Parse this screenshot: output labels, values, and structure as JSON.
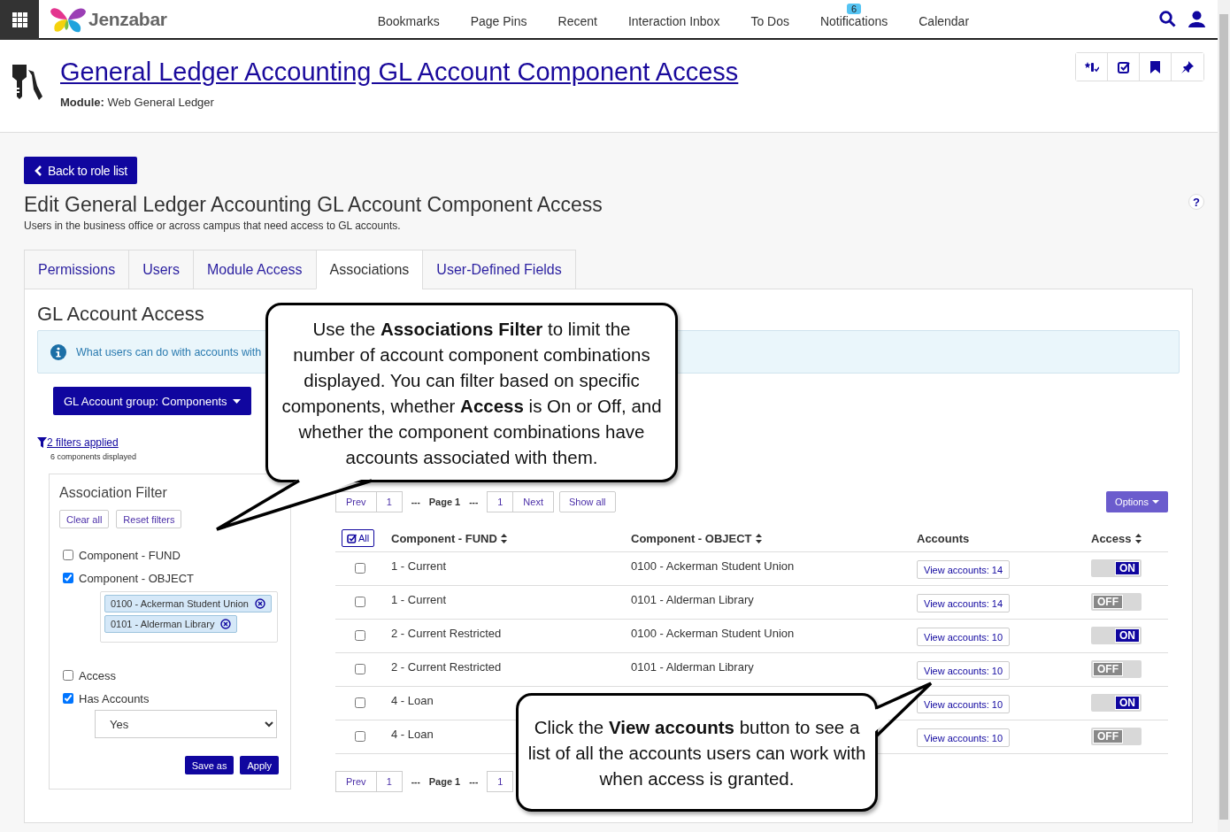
{
  "topbar": {
    "logo_text": "Jenzabar",
    "nav": [
      {
        "label": "Bookmarks"
      },
      {
        "label": "Page Pins"
      },
      {
        "label": "Recent"
      },
      {
        "label": "Interaction Inbox"
      },
      {
        "label": "To Dos"
      },
      {
        "label": "Notifications",
        "badge": "6"
      },
      {
        "label": "Calendar"
      }
    ]
  },
  "header": {
    "title": "General Ledger Accounting GL Account Component Access",
    "module_label": "Module:",
    "module_value": "Web General Ledger"
  },
  "back_button": "Back to role list",
  "page_title": "Edit General Ledger Accounting GL Account Component Access",
  "description": "Users in the business office or across campus that need access to GL accounts.",
  "help": "?",
  "tabs": [
    {
      "label": "Permissions",
      "selected": false
    },
    {
      "label": "Users",
      "selected": false
    },
    {
      "label": "Module Access",
      "selected": false
    },
    {
      "label": "Associations",
      "selected": true
    },
    {
      "label": "User-Defined Fields",
      "selected": false
    }
  ],
  "section": {
    "title": "GL Account Access",
    "info": "What users can do with accounts with",
    "group_button": "GL Account group: Components",
    "filters_link": "2 filters applied",
    "filters_note": "6 components displayed"
  },
  "filter": {
    "title": "Association Filter",
    "buttons": [
      "Clear all",
      "Reset filters"
    ],
    "items": [
      {
        "kind": "check",
        "label": "Component - FUND",
        "checked": false
      },
      {
        "kind": "chips",
        "label": "Component - OBJECT",
        "checked": true,
        "chips": [
          "0100 - Ackerman Student Union",
          "0101 - Alderman Library"
        ]
      },
      {
        "kind": "check",
        "label": "Access",
        "checked": false
      },
      {
        "kind": "select",
        "label": "Has Accounts",
        "checked": true,
        "value": "Yes"
      }
    ],
    "actions": [
      "Save as",
      "Apply"
    ]
  },
  "pager_top": [
    {
      "kind": "button",
      "label": "Prev"
    },
    {
      "kind": "button",
      "label": "1"
    },
    {
      "kind": "text",
      "label": "---"
    },
    {
      "kind": "bold",
      "label": "Page 1"
    },
    {
      "kind": "text",
      "label": "---"
    },
    {
      "kind": "button",
      "label": "1"
    },
    {
      "kind": "button",
      "label": "Next"
    },
    {
      "kind": "action",
      "label": "Show all"
    }
  ],
  "options_button": "Options",
  "table": {
    "select_all": "All",
    "columns": [
      {
        "label": "Component - FUND",
        "sortable": true
      },
      {
        "label": "Component - OBJECT",
        "sortable": true
      },
      {
        "label": "Accounts",
        "sortable": false
      },
      {
        "label": "Access",
        "sortable": true
      }
    ],
    "rows": [
      {
        "checked": false,
        "fund": "1 - Current",
        "object": "0100 - Ackerman Student Union",
        "accounts": "View accounts: 14",
        "on": true,
        "access_label": "ON"
      },
      {
        "checked": false,
        "fund": "1 - Current",
        "object": "0101 - Alderman Library",
        "accounts": "View accounts: 14",
        "on": false,
        "access_label": "OFF"
      },
      {
        "checked": false,
        "fund": "2 - Current Restricted",
        "object": "0100 - Ackerman Student Union",
        "accounts": "View accounts: 10",
        "on": true,
        "access_label": "ON"
      },
      {
        "checked": false,
        "fund": "2 - Current Restricted",
        "object": "0101 - Alderman Library",
        "accounts": "View accounts: 10",
        "on": false,
        "access_label": "OFF"
      },
      {
        "checked": false,
        "fund": "4 - Loan",
        "accounts": "View accounts: 10",
        "on": true,
        "access_label": "ON"
      },
      {
        "checked": false,
        "fund": "4 - Loan",
        "accounts": "View accounts: 10",
        "on": false,
        "access_label": "OFF"
      }
    ]
  },
  "pager_bottom": [
    {
      "kind": "button",
      "label": "Prev"
    },
    {
      "kind": "button",
      "label": "1"
    },
    {
      "kind": "text",
      "label": "---"
    },
    {
      "kind": "bold",
      "label": "Page 1"
    },
    {
      "kind": "text",
      "label": "---"
    },
    {
      "kind": "button",
      "label": "1"
    }
  ],
  "callouts": [
    {
      "text": "Use the **Associations Filter** to limit the number of account component combinations displayed. You can filter based on specific components, whether **Access** is On or Off, and whether the component combinations have accounts associated with them."
    },
    {
      "text": "Click the **View accounts** button to see a list of all the accounts users can work with when access is granted."
    }
  ]
}
